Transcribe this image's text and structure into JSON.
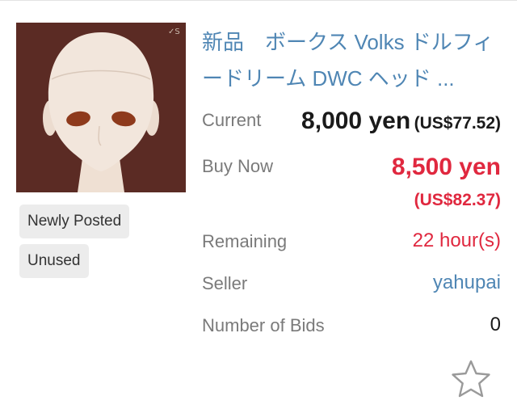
{
  "listing": {
    "title": "新品　ボークス Volks ドルフィードリーム DWC ヘッド ...",
    "image_alt": "doll head",
    "badges": [
      "Newly Posted",
      "Unused"
    ],
    "current": {
      "label": "Current",
      "price": "8,000 yen",
      "usd": "(US$77.52)"
    },
    "buy_now": {
      "label": "Buy Now",
      "price": "8,500 yen",
      "usd": "(US$82.37)"
    },
    "remaining": {
      "label": "Remaining",
      "value": "22 hour(s)"
    },
    "seller": {
      "label": "Seller",
      "value": "yahupai"
    },
    "bids": {
      "label": "Number of Bids",
      "value": "0"
    },
    "watch_icon": "star-outline-icon"
  },
  "colors": {
    "link": "#4f86b4",
    "price_red": "#e0283f",
    "label_gray": "#7a7a7a",
    "badge_bg": "#ececec"
  }
}
